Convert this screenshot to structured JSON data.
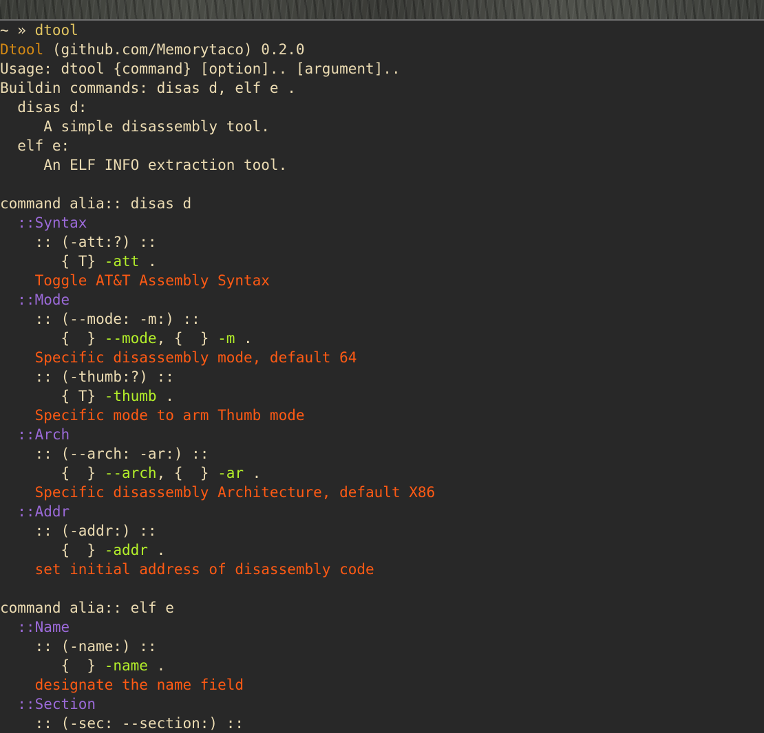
{
  "colors": {
    "background": "#282828",
    "default_text": "#ebdbb2",
    "prompt_command": "#e2c561",
    "app_name": "#d58a14",
    "section_header": "#9b6ad8",
    "option_flag": "#b4f02a",
    "description": "#ff5a14"
  },
  "terminal": {
    "lines": [
      [
        {
          "text": "~ » ",
          "color": "default"
        },
        {
          "text": "dtool",
          "color": "yellow"
        }
      ],
      [
        {
          "text": "Dtool",
          "color": "orange"
        },
        {
          "text": " (github.com/Memorytaco) 0.2.0",
          "color": "default"
        }
      ],
      [
        {
          "text": "Usage: dtool {command} [option].. [argument]..",
          "color": "default"
        }
      ],
      [
        {
          "text": "Buildin commands: disas d, elf e .",
          "color": "default"
        }
      ],
      [
        {
          "text": "  disas d:",
          "color": "default"
        }
      ],
      [
        {
          "text": "     A simple disassembly tool.",
          "color": "default"
        }
      ],
      [
        {
          "text": "  elf e:",
          "color": "default"
        }
      ],
      [
        {
          "text": "     An ELF INFO extraction tool.",
          "color": "default"
        }
      ],
      [],
      [
        {
          "text": "command alia:: disas d",
          "color": "default"
        }
      ],
      [
        {
          "text": "  ::Syntax",
          "color": "purple"
        }
      ],
      [
        {
          "text": "    :: (-att:?) ::",
          "color": "default"
        }
      ],
      [
        {
          "text": "       { T} ",
          "color": "default"
        },
        {
          "text": "-att",
          "color": "green"
        },
        {
          "text": " .",
          "color": "default"
        }
      ],
      [
        {
          "text": "    Toggle AT&T Assembly Syntax",
          "color": "red"
        }
      ],
      [
        {
          "text": "  ::Mode",
          "color": "purple"
        }
      ],
      [
        {
          "text": "    :: (--mode: -m:) ::",
          "color": "default"
        }
      ],
      [
        {
          "text": "       {  } ",
          "color": "default"
        },
        {
          "text": "--mode",
          "color": "green"
        },
        {
          "text": ", {  } ",
          "color": "default"
        },
        {
          "text": "-m",
          "color": "green"
        },
        {
          "text": " .",
          "color": "default"
        }
      ],
      [
        {
          "text": "    Specific disassembly mode, default 64",
          "color": "red"
        }
      ],
      [
        {
          "text": "    :: (-thumb:?) ::",
          "color": "default"
        }
      ],
      [
        {
          "text": "       { T} ",
          "color": "default"
        },
        {
          "text": "-thumb",
          "color": "green"
        },
        {
          "text": " .",
          "color": "default"
        }
      ],
      [
        {
          "text": "    Specific mode to arm Thumb mode",
          "color": "red"
        }
      ],
      [
        {
          "text": "  ::Arch",
          "color": "purple"
        }
      ],
      [
        {
          "text": "    :: (--arch: -ar:) ::",
          "color": "default"
        }
      ],
      [
        {
          "text": "       {  } ",
          "color": "default"
        },
        {
          "text": "--arch",
          "color": "green"
        },
        {
          "text": ", {  } ",
          "color": "default"
        },
        {
          "text": "-ar",
          "color": "green"
        },
        {
          "text": " .",
          "color": "default"
        }
      ],
      [
        {
          "text": "    Specific disassembly Architecture, default X86",
          "color": "red"
        }
      ],
      [
        {
          "text": "  ::Addr",
          "color": "purple"
        }
      ],
      [
        {
          "text": "    :: (-addr:) ::",
          "color": "default"
        }
      ],
      [
        {
          "text": "       {  } ",
          "color": "default"
        },
        {
          "text": "-addr",
          "color": "green"
        },
        {
          "text": " .",
          "color": "default"
        }
      ],
      [
        {
          "text": "    set initial address of disassembly code",
          "color": "red"
        }
      ],
      [],
      [
        {
          "text": "command alia:: elf e",
          "color": "default"
        }
      ],
      [
        {
          "text": "  ::Name",
          "color": "purple"
        }
      ],
      [
        {
          "text": "    :: (-name:) ::",
          "color": "default"
        }
      ],
      [
        {
          "text": "       {  } ",
          "color": "default"
        },
        {
          "text": "-name",
          "color": "green"
        },
        {
          "text": " .",
          "color": "default"
        }
      ],
      [
        {
          "text": "    designate the name field",
          "color": "red"
        }
      ],
      [
        {
          "text": "  ::Section",
          "color": "purple"
        }
      ],
      [
        {
          "text": "    :: (-sec: --section:) ::",
          "color": "default"
        }
      ]
    ]
  }
}
